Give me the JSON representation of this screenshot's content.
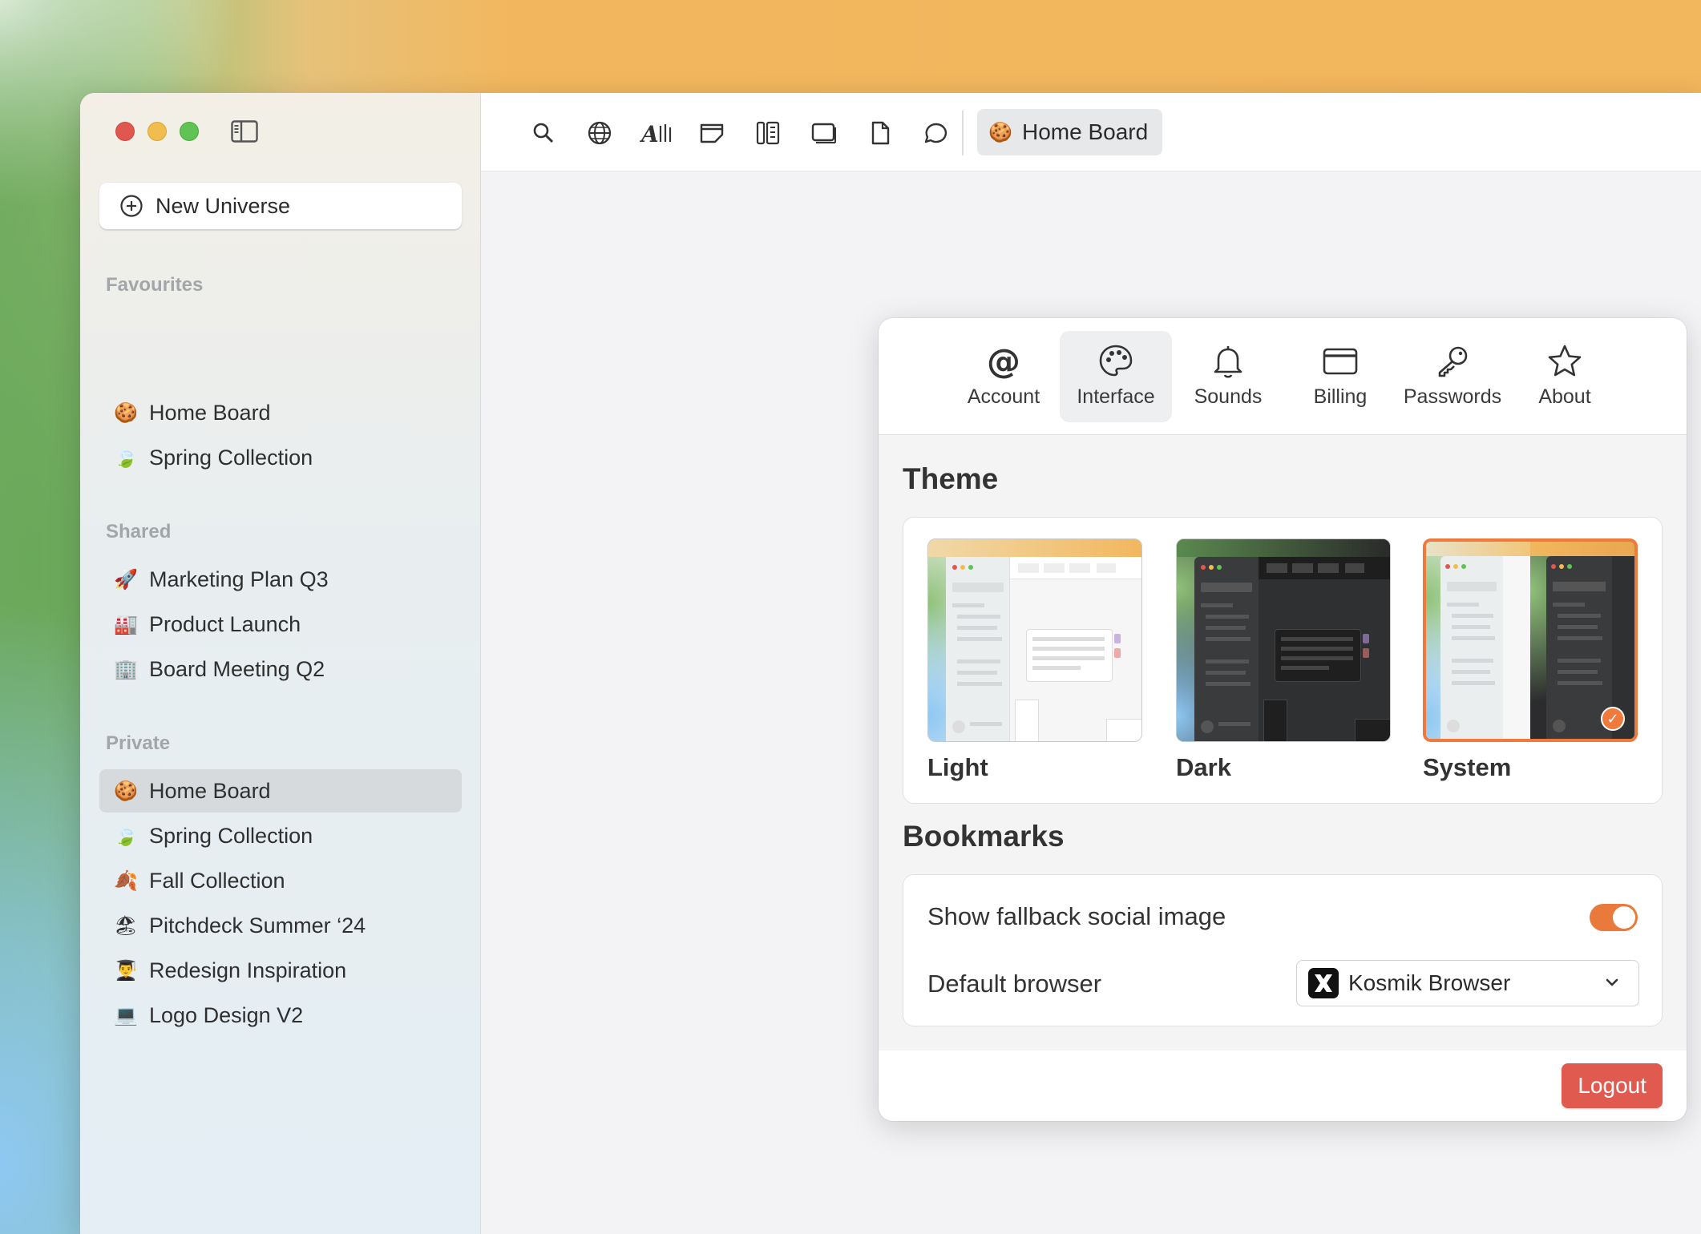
{
  "window": {
    "traffic_lights": [
      "close",
      "minimize",
      "zoom"
    ]
  },
  "sidebar": {
    "new_universe_label": "New Universe",
    "sections": {
      "favourites_label": "Favourites",
      "shared_label": "Shared",
      "private_label": "Private"
    },
    "favourites": [
      {
        "label": "Home Board",
        "icon": "cookie-icon"
      },
      {
        "label": "Spring Collection",
        "icon": "leaf-icon"
      }
    ],
    "shared": [
      {
        "label": "Marketing Plan Q3",
        "icon": "rocket-icon"
      },
      {
        "label": "Product Launch",
        "icon": "factory-icon"
      },
      {
        "label": "Board Meeting Q2",
        "icon": "office-building-icon"
      }
    ],
    "private": [
      {
        "label": "Home Board",
        "icon": "cookie-icon",
        "active": true
      },
      {
        "label": "Spring Collection",
        "icon": "leaf-icon"
      },
      {
        "label": "Fall Collection",
        "icon": "fallen-leaf-icon"
      },
      {
        "label": "Pitchdeck Summer ‘24",
        "icon": "beach-icon"
      },
      {
        "label": "Redesign Inspiration",
        "icon": "student-icon"
      },
      {
        "label": "Logo Design V2",
        "icon": "computer-icon"
      }
    ]
  },
  "toolbar": {
    "icons": [
      "search-icon",
      "globe-icon",
      "text-icon",
      "note-icon",
      "panels-icon",
      "window-icon",
      "file-icon",
      "bubble-icon"
    ],
    "current_board": "Home Board"
  },
  "settings": {
    "tabs": [
      {
        "label": "Account",
        "icon": "at-icon"
      },
      {
        "label": "Interface",
        "icon": "palette-icon",
        "active": true
      },
      {
        "label": "Sounds",
        "icon": "bell-icon"
      },
      {
        "label": "Billing",
        "icon": "credit-card-icon"
      },
      {
        "label": "Passwords",
        "icon": "key-icon"
      },
      {
        "label": "About",
        "icon": "star-icon"
      }
    ],
    "theme": {
      "heading": "Theme",
      "options": [
        "Light",
        "Dark",
        "System"
      ],
      "selected": "System"
    },
    "bookmarks": {
      "heading": "Bookmarks",
      "fallback_label": "Show fallback social image",
      "fallback_enabled": true,
      "browser_label": "Default browser",
      "browser_value": "Kosmik Browser"
    },
    "logout_label": "Logout"
  },
  "colors": {
    "accent": "#f07a3c",
    "logout": "#e05a4f",
    "active_item": "#d6dadc"
  }
}
